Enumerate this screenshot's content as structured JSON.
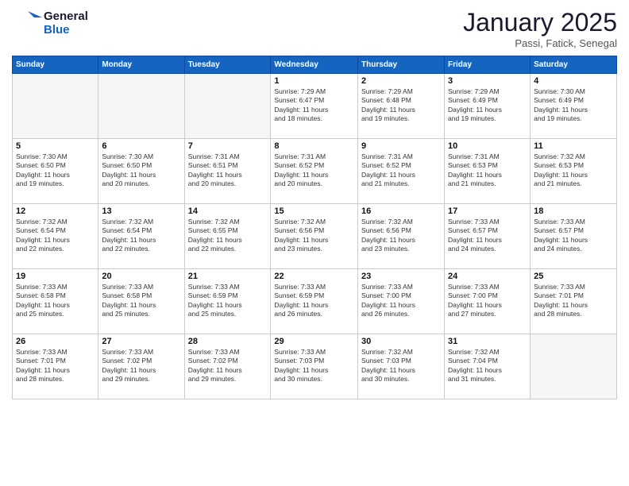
{
  "logo": {
    "general": "General",
    "blue": "Blue"
  },
  "header": {
    "month": "January 2025",
    "location": "Passi, Fatick, Senegal"
  },
  "weekdays": [
    "Sunday",
    "Monday",
    "Tuesday",
    "Wednesday",
    "Thursday",
    "Friday",
    "Saturday"
  ],
  "weeks": [
    [
      {
        "day": "",
        "info": ""
      },
      {
        "day": "",
        "info": ""
      },
      {
        "day": "",
        "info": ""
      },
      {
        "day": "1",
        "info": "Sunrise: 7:29 AM\nSunset: 6:47 PM\nDaylight: 11 hours\nand 18 minutes."
      },
      {
        "day": "2",
        "info": "Sunrise: 7:29 AM\nSunset: 6:48 PM\nDaylight: 11 hours\nand 19 minutes."
      },
      {
        "day": "3",
        "info": "Sunrise: 7:29 AM\nSunset: 6:49 PM\nDaylight: 11 hours\nand 19 minutes."
      },
      {
        "day": "4",
        "info": "Sunrise: 7:30 AM\nSunset: 6:49 PM\nDaylight: 11 hours\nand 19 minutes."
      }
    ],
    [
      {
        "day": "5",
        "info": "Sunrise: 7:30 AM\nSunset: 6:50 PM\nDaylight: 11 hours\nand 19 minutes."
      },
      {
        "day": "6",
        "info": "Sunrise: 7:30 AM\nSunset: 6:50 PM\nDaylight: 11 hours\nand 20 minutes."
      },
      {
        "day": "7",
        "info": "Sunrise: 7:31 AM\nSunset: 6:51 PM\nDaylight: 11 hours\nand 20 minutes."
      },
      {
        "day": "8",
        "info": "Sunrise: 7:31 AM\nSunset: 6:52 PM\nDaylight: 11 hours\nand 20 minutes."
      },
      {
        "day": "9",
        "info": "Sunrise: 7:31 AM\nSunset: 6:52 PM\nDaylight: 11 hours\nand 21 minutes."
      },
      {
        "day": "10",
        "info": "Sunrise: 7:31 AM\nSunset: 6:53 PM\nDaylight: 11 hours\nand 21 minutes."
      },
      {
        "day": "11",
        "info": "Sunrise: 7:32 AM\nSunset: 6:53 PM\nDaylight: 11 hours\nand 21 minutes."
      }
    ],
    [
      {
        "day": "12",
        "info": "Sunrise: 7:32 AM\nSunset: 6:54 PM\nDaylight: 11 hours\nand 22 minutes."
      },
      {
        "day": "13",
        "info": "Sunrise: 7:32 AM\nSunset: 6:54 PM\nDaylight: 11 hours\nand 22 minutes."
      },
      {
        "day": "14",
        "info": "Sunrise: 7:32 AM\nSunset: 6:55 PM\nDaylight: 11 hours\nand 22 minutes."
      },
      {
        "day": "15",
        "info": "Sunrise: 7:32 AM\nSunset: 6:56 PM\nDaylight: 11 hours\nand 23 minutes."
      },
      {
        "day": "16",
        "info": "Sunrise: 7:32 AM\nSunset: 6:56 PM\nDaylight: 11 hours\nand 23 minutes."
      },
      {
        "day": "17",
        "info": "Sunrise: 7:33 AM\nSunset: 6:57 PM\nDaylight: 11 hours\nand 24 minutes."
      },
      {
        "day": "18",
        "info": "Sunrise: 7:33 AM\nSunset: 6:57 PM\nDaylight: 11 hours\nand 24 minutes."
      }
    ],
    [
      {
        "day": "19",
        "info": "Sunrise: 7:33 AM\nSunset: 6:58 PM\nDaylight: 11 hours\nand 25 minutes."
      },
      {
        "day": "20",
        "info": "Sunrise: 7:33 AM\nSunset: 6:58 PM\nDaylight: 11 hours\nand 25 minutes."
      },
      {
        "day": "21",
        "info": "Sunrise: 7:33 AM\nSunset: 6:59 PM\nDaylight: 11 hours\nand 25 minutes."
      },
      {
        "day": "22",
        "info": "Sunrise: 7:33 AM\nSunset: 6:59 PM\nDaylight: 11 hours\nand 26 minutes."
      },
      {
        "day": "23",
        "info": "Sunrise: 7:33 AM\nSunset: 7:00 PM\nDaylight: 11 hours\nand 26 minutes."
      },
      {
        "day": "24",
        "info": "Sunrise: 7:33 AM\nSunset: 7:00 PM\nDaylight: 11 hours\nand 27 minutes."
      },
      {
        "day": "25",
        "info": "Sunrise: 7:33 AM\nSunset: 7:01 PM\nDaylight: 11 hours\nand 28 minutes."
      }
    ],
    [
      {
        "day": "26",
        "info": "Sunrise: 7:33 AM\nSunset: 7:01 PM\nDaylight: 11 hours\nand 28 minutes."
      },
      {
        "day": "27",
        "info": "Sunrise: 7:33 AM\nSunset: 7:02 PM\nDaylight: 11 hours\nand 29 minutes."
      },
      {
        "day": "28",
        "info": "Sunrise: 7:33 AM\nSunset: 7:02 PM\nDaylight: 11 hours\nand 29 minutes."
      },
      {
        "day": "29",
        "info": "Sunrise: 7:33 AM\nSunset: 7:03 PM\nDaylight: 11 hours\nand 30 minutes."
      },
      {
        "day": "30",
        "info": "Sunrise: 7:32 AM\nSunset: 7:03 PM\nDaylight: 11 hours\nand 30 minutes."
      },
      {
        "day": "31",
        "info": "Sunrise: 7:32 AM\nSunset: 7:04 PM\nDaylight: 11 hours\nand 31 minutes."
      },
      {
        "day": "",
        "info": ""
      }
    ]
  ]
}
